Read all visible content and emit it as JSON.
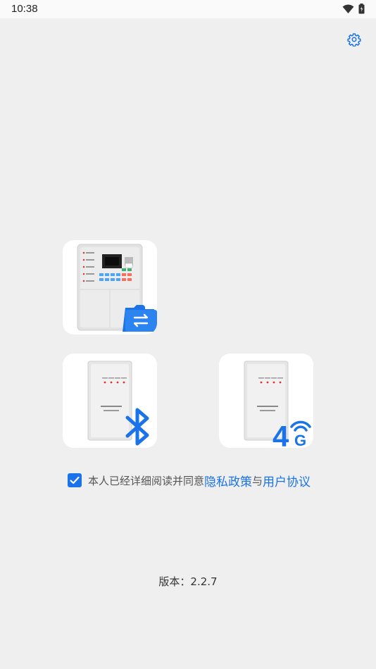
{
  "status_bar": {
    "time": "10:38",
    "icons": [
      "wifi-icon",
      "battery-icon"
    ]
  },
  "header": {
    "settings_icon": "gear-icon",
    "accent_color": "#1a73e8"
  },
  "device_options": [
    {
      "name": "panel-transfer",
      "icon": "transfer-icon"
    },
    {
      "name": "bluetooth-device",
      "icon": "bluetooth-icon"
    },
    {
      "name": "4g-device",
      "icon": "4g-signal-icon",
      "badge_text": "4G"
    }
  ],
  "agreement": {
    "checked": true,
    "text": "本人已经详细阅读并同意",
    "privacy_link": "隐私政策",
    "joiner": "与",
    "user_agreement_link": "用户协议"
  },
  "footer": {
    "version_text": "版本：2.2.7"
  }
}
